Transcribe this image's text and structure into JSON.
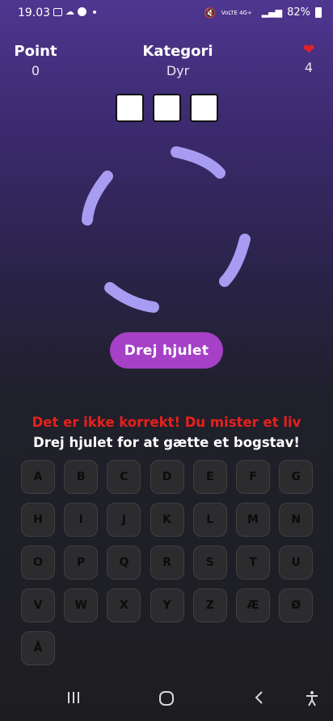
{
  "status_bar": {
    "time": "19.03",
    "network": "VoLTE 4G+",
    "battery": "82%"
  },
  "header": {
    "points_label": "Point",
    "points_value": "0",
    "category_label": "Kategori",
    "category_value": "Dyr",
    "lives_value": "4"
  },
  "word": {
    "hidden_letters": 3
  },
  "wheel": {
    "color": "#a89cf2"
  },
  "spin_button": {
    "label": "Drej hjulet",
    "color": "#a540c7"
  },
  "messages": {
    "error": "Det er ikke korrekt! Du mister et liv",
    "instruction": "Drej hjulet for at gætte et bogstav!",
    "error_color": "#e8201b"
  },
  "keyboard": {
    "keys": [
      "A",
      "B",
      "C",
      "D",
      "E",
      "F",
      "G",
      "H",
      "I",
      "J",
      "K",
      "L",
      "M",
      "N",
      "O",
      "P",
      "Q",
      "R",
      "S",
      "T",
      "U",
      "V",
      "W",
      "X",
      "Y",
      "Z",
      "Æ",
      "Ø",
      "Å"
    ]
  },
  "nav": {
    "recents_icon": "recents-icon",
    "home_icon": "home-icon",
    "back_icon": "back-icon",
    "accessibility_icon": "accessibility-icon"
  }
}
